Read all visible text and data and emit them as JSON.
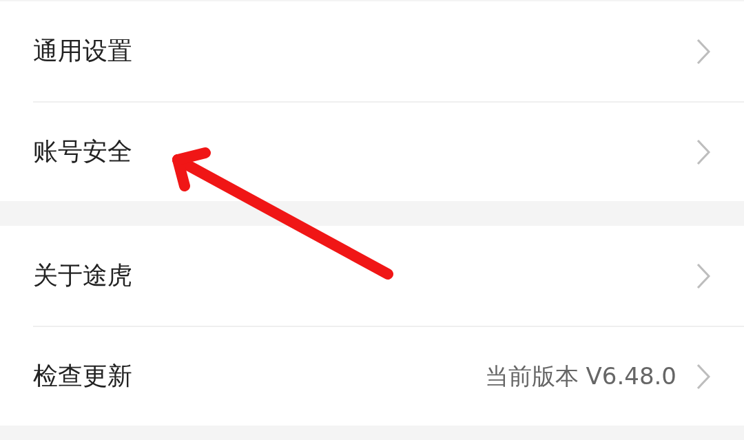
{
  "sections": [
    {
      "items": [
        {
          "label": "通用设置"
        },
        {
          "label": "账号安全"
        }
      ]
    },
    {
      "items": [
        {
          "label": "关于途虎"
        },
        {
          "label": "检查更新",
          "value": "当前版本 V6.48.0"
        }
      ]
    }
  ]
}
